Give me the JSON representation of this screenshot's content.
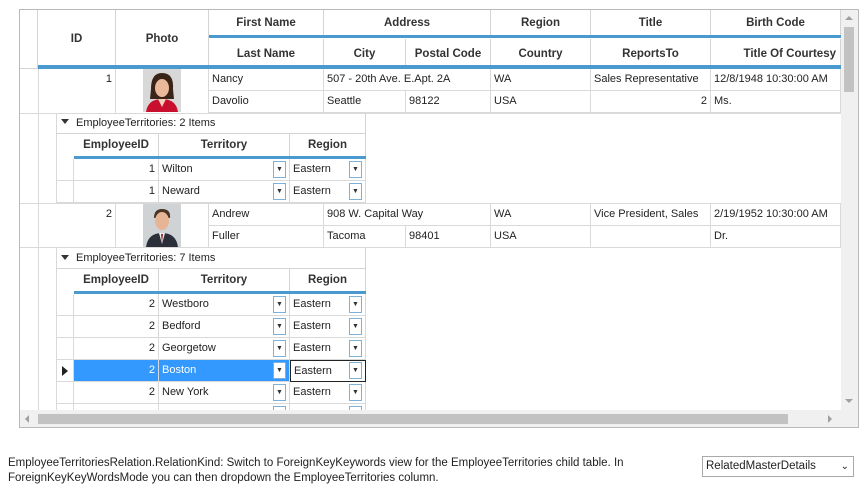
{
  "headers": {
    "id": "ID",
    "photo": "Photo",
    "first_name": "First Name",
    "last_name": "Last Name",
    "address": "Address",
    "city": "City",
    "postal_code": "Postal Code",
    "region": "Region",
    "country": "Country",
    "title": "Title",
    "reports_to": "ReportsTo",
    "birth_code": "Birth Code",
    "title_of_courtesy": "Title Of Courtesy"
  },
  "employees": [
    {
      "id": "1",
      "first_name": "Nancy",
      "last_name": "Davolio",
      "address": "507 - 20th Ave. E.Apt. 2A",
      "city": "Seattle",
      "postal_code": "98122",
      "region": "WA",
      "country": "USA",
      "title": "Sales Representative",
      "reports_to": "2",
      "birth": "12/8/1948 10:30:00 AM",
      "courtesy": "Ms.",
      "photo_icon": "person-photo-woman"
    },
    {
      "id": "2",
      "first_name": "Andrew",
      "last_name": "Fuller",
      "address": "908 W. Capital Way",
      "city": "Tacoma",
      "postal_code": "98401",
      "region": "WA",
      "country": "USA",
      "title": "Vice President, Sales",
      "reports_to": "",
      "birth": "2/19/1952 10:30:00 AM",
      "courtesy": "Dr.",
      "photo_icon": "person-photo-man"
    }
  ],
  "child_headers": {
    "employee_id": "EmployeeID",
    "territory": "Territory",
    "region": "Region"
  },
  "child1": {
    "title": "EmployeeTerritories: 2 Items",
    "rows": [
      {
        "id": "1",
        "territory": "Wilton",
        "region": "Eastern"
      },
      {
        "id": "1",
        "territory": "Neward",
        "region": "Eastern"
      }
    ]
  },
  "child2": {
    "title": "EmployeeTerritories: 7 Items",
    "rows": [
      {
        "id": "2",
        "territory": "Westboro",
        "region": "Eastern"
      },
      {
        "id": "2",
        "territory": "Bedford",
        "region": "Eastern"
      },
      {
        "id": "2",
        "territory": "Georgetow",
        "region": "Eastern"
      },
      {
        "id": "2",
        "territory": "Boston",
        "region": "Eastern"
      },
      {
        "id": "2",
        "territory": "New York",
        "region": "Eastern"
      }
    ]
  },
  "description": {
    "line1": "EmployeeTerritoriesRelation.RelationKind:  Switch to ForeignKeyKeywords view for the EmployeeTerritories child table. In",
    "line2": "ForeignKeyKeyWordsMode you can then dropdown the EmployeeTerritories column."
  },
  "relation_select": {
    "value": "RelatedMasterDetails"
  },
  "colors": {
    "accent": "#4a9ad0",
    "selection": "#3399ff"
  }
}
